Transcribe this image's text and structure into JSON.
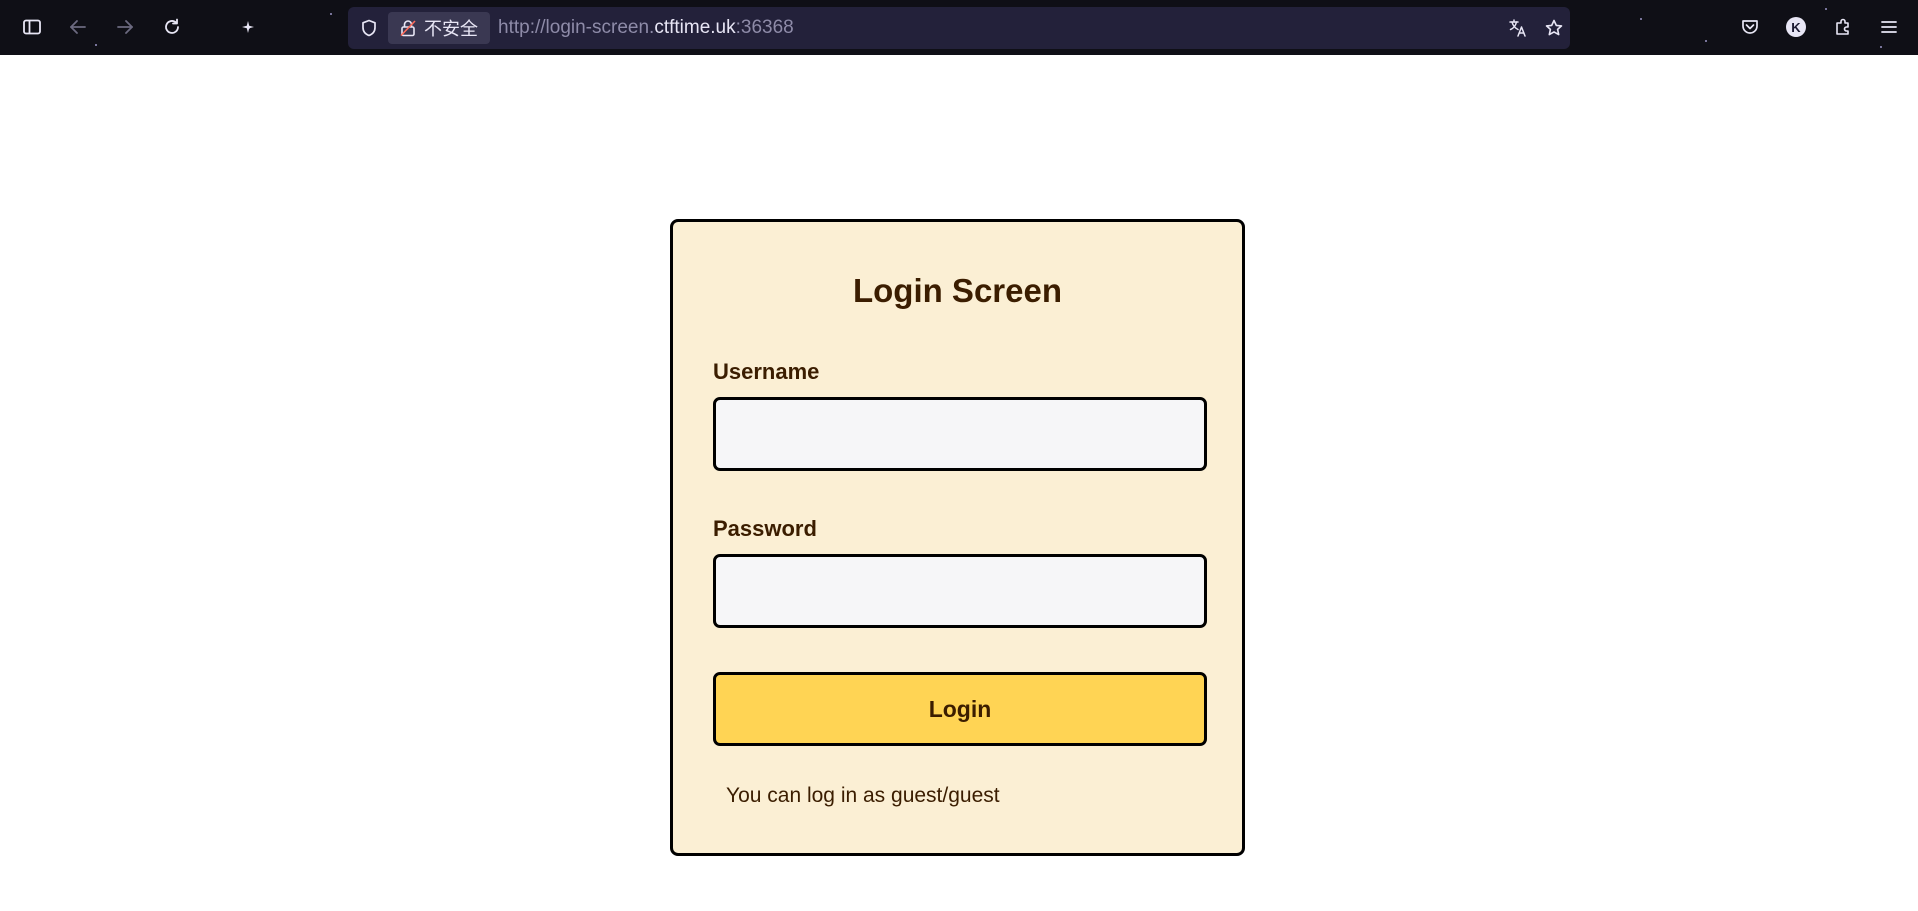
{
  "browser": {
    "security_label": "不安全",
    "url": {
      "prefix": "http://login-screen.",
      "host": "ctftime.uk",
      "suffix": ":36368"
    },
    "icons": {
      "sidebar": "sidebar-icon",
      "back": "back-arrow-icon",
      "forward": "forward-arrow-icon",
      "reload": "reload-icon",
      "shield": "shield-icon",
      "insecure_lock": "insecure-lock-icon",
      "translate": "translate-icon",
      "bookmark": "star-bookmark-icon",
      "pocket": "pocket-icon",
      "extensions": "puzzle-extensions-icon",
      "menu": "hamburger-menu-icon"
    },
    "profile_initial": "K"
  },
  "login": {
    "title": "Login Screen",
    "username_label": "Username",
    "username_value": "",
    "password_label": "Password",
    "password_value": "",
    "button_label": "Login",
    "hint": "You can log in as guest/guest"
  },
  "colors": {
    "card_background": "#fbefd4",
    "text": "#3b1d00",
    "button": "#ffd454",
    "input_background": "#f6f6f8",
    "toolbar": "#0f0f16",
    "urlbar": "#23213a"
  }
}
